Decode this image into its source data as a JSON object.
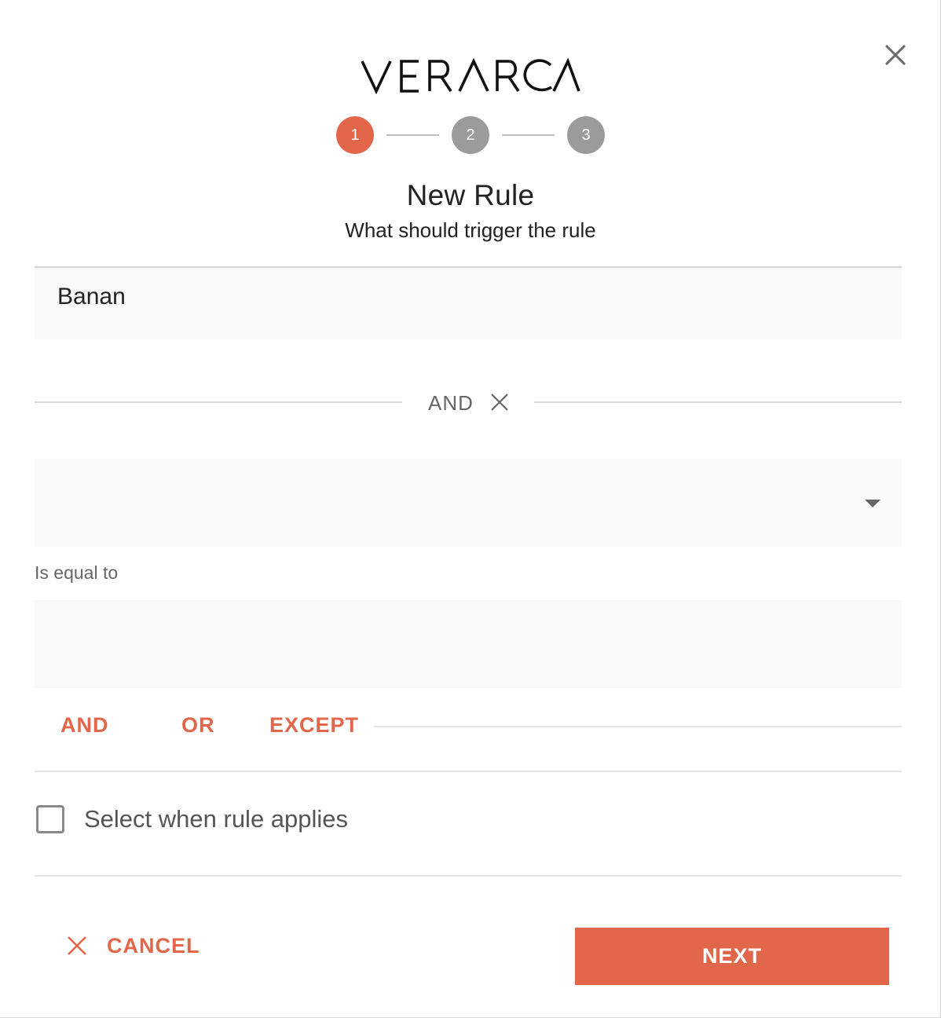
{
  "brand": {
    "logo_text": "VERARCA",
    "accent_color": "#e2674a"
  },
  "stepper": {
    "steps": [
      "1",
      "2",
      "3"
    ],
    "active_step": 1
  },
  "header": {
    "title": "New Rule",
    "subtitle": "What should trigger the rule"
  },
  "conditions": {
    "first_value": "Banan",
    "joiner_label": "AND",
    "second": {
      "field_value": "",
      "operator_label": "Is equal to",
      "compare_value": ""
    }
  },
  "operators": {
    "and_label": "AND",
    "or_label": "OR",
    "except_label": "EXCEPT"
  },
  "checkbox": {
    "label": "Select when rule applies",
    "checked": false
  },
  "footer": {
    "cancel_label": "CANCEL",
    "next_label": "NEXT"
  },
  "icons": [
    "close-icon",
    "remove-condition-icon",
    "dropdown-caret-icon",
    "cancel-x-icon"
  ]
}
